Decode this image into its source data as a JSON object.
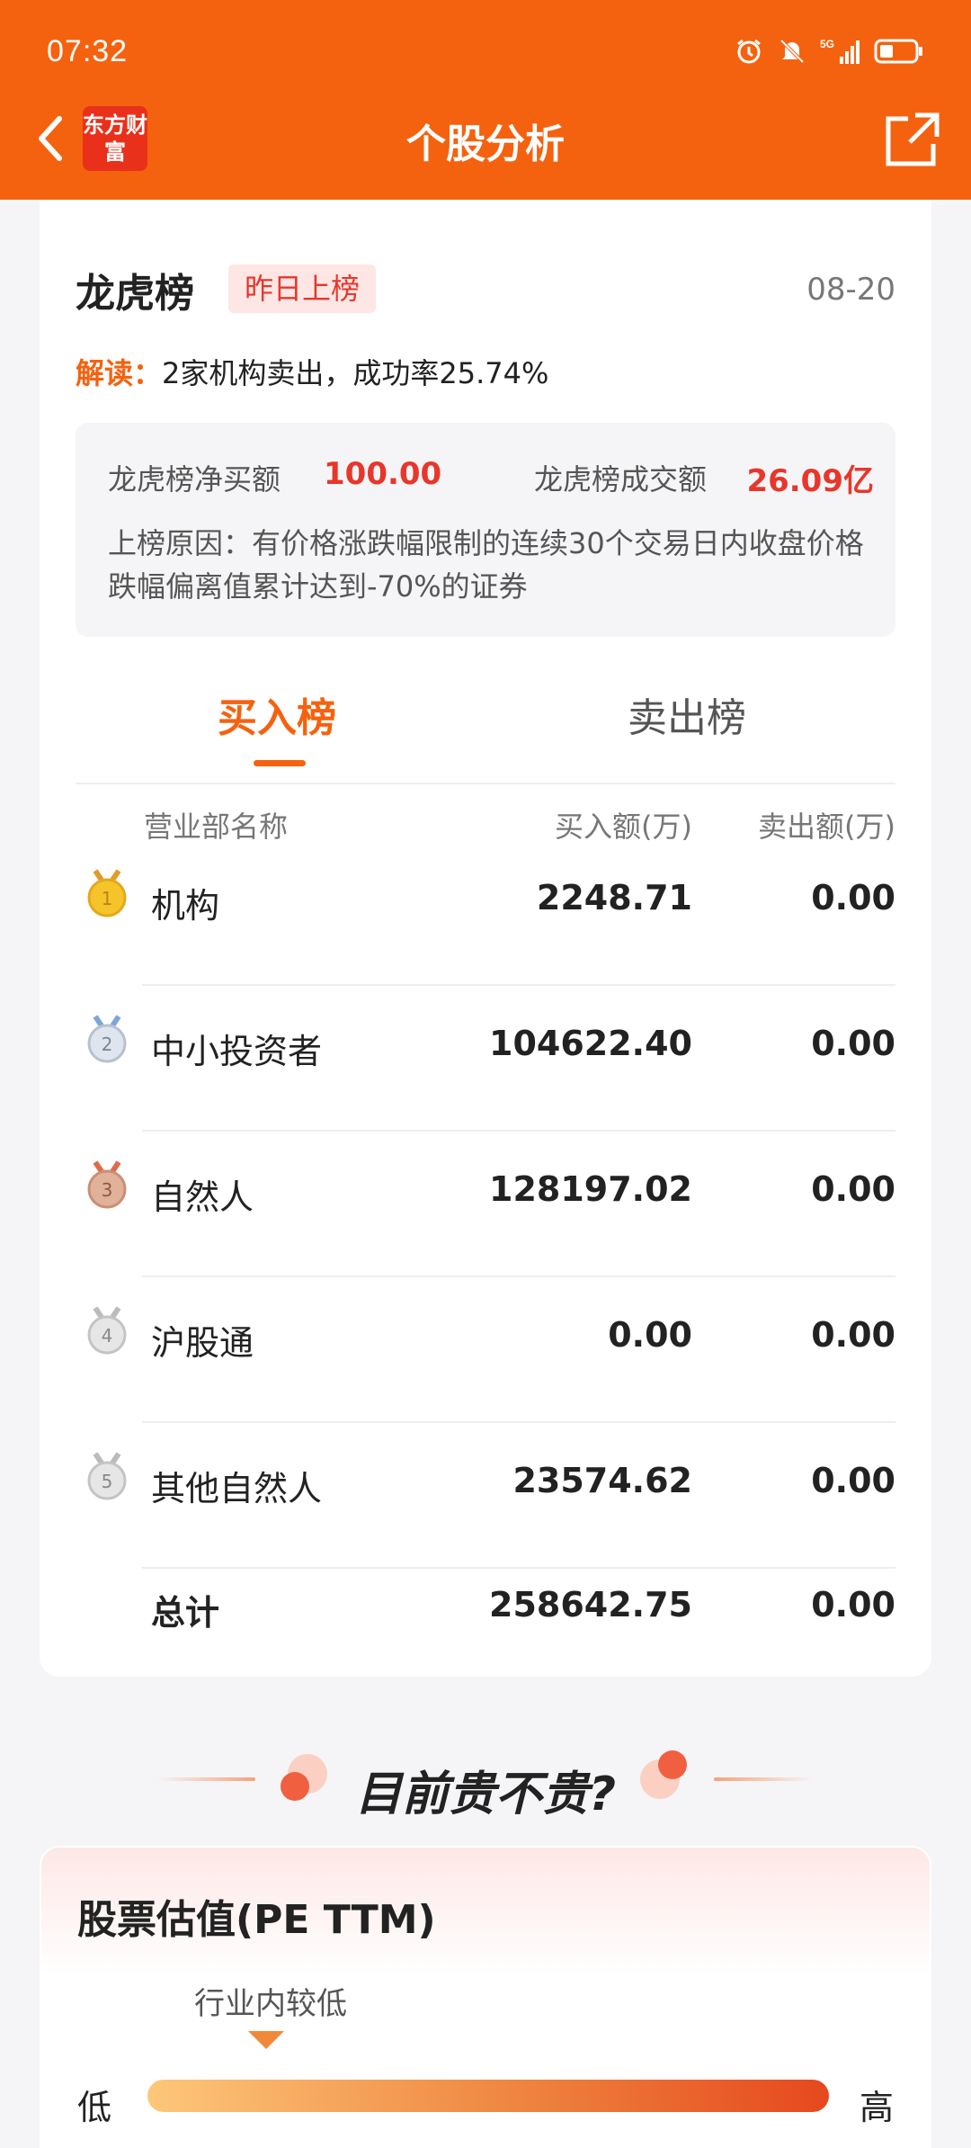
{
  "status_bar": {
    "time": "07:32",
    "network": "5G"
  },
  "header": {
    "title": "个股分析",
    "logo_text": "东方财富"
  },
  "lhb": {
    "title": "龙虎榜",
    "badge": "昨日上榜",
    "date": "08-20",
    "jiedu_label": "解读：",
    "jiedu_text": "2家机构卖出，成功率25.74%",
    "net_buy_label": "龙虎榜净买额",
    "net_buy_value": "100.00",
    "turnover_label": "龙虎榜成交额",
    "turnover_value": "26.09亿",
    "reason": "上榜原因：有价格涨跌幅限制的连续30个交易日内收盘价格跌幅偏离值累计达到-70%的证券"
  },
  "tabs": {
    "buy": "买入榜",
    "sell": "卖出榜",
    "active": "buy"
  },
  "table": {
    "headers": [
      "营业部名称",
      "买入额(万)",
      "卖出额(万)"
    ],
    "rows": [
      {
        "rank": "1",
        "name": "机构",
        "buy": "2248.71",
        "sell": "0.00"
      },
      {
        "rank": "2",
        "name": "中小投资者",
        "buy": "104622.40",
        "sell": "0.00"
      },
      {
        "rank": "3",
        "name": "自然人",
        "buy": "128197.02",
        "sell": "0.00"
      },
      {
        "rank": "4",
        "name": "沪股通",
        "buy": "0.00",
        "sell": "0.00"
      },
      {
        "rank": "5",
        "name": "其他自然人",
        "buy": "23574.62",
        "sell": "0.00"
      }
    ],
    "total": {
      "name": "总计",
      "buy": "258642.75",
      "sell": "0.00"
    }
  },
  "valuation_section": {
    "title": "目前贵不贵?"
  },
  "pe": {
    "title": "股票估值(PE TTM)",
    "marker_label": "行业内较低",
    "low": "低",
    "high": "高"
  },
  "colors": {
    "brand": "#f5620f",
    "red": "#e8362b"
  }
}
